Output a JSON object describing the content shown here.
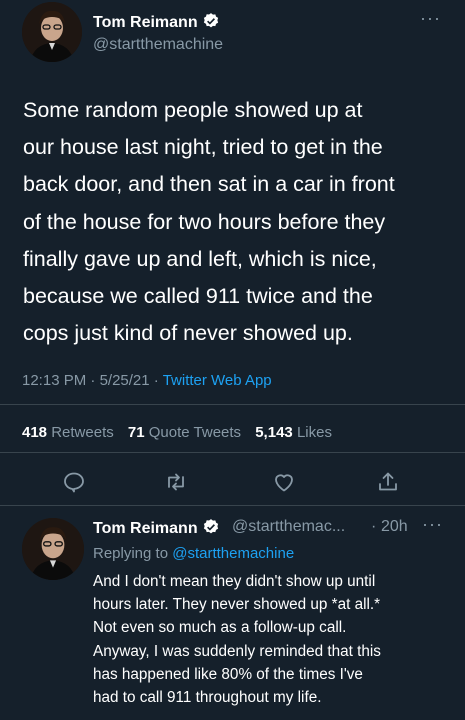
{
  "main_tweet": {
    "author_name": "Tom Reimann",
    "handle": "@startthemachine",
    "more_label": "···",
    "text": "Some random people showed up at\nour house last night, tried to get in the\nback door, and then sat in a car in front\nof the house for two hours before they\nfinally gave up and left, which is nice,\nbecause we called 911 twice and the\ncops just kind of never showed up.",
    "time": "12:13 PM",
    "date": "5/25/21",
    "separator": "·",
    "source": "Twitter Web App",
    "stats": {
      "retweets_count": "418",
      "retweets_label": "Retweets",
      "quotes_count": "71",
      "quotes_label": "Quote Tweets",
      "likes_count": "5,143",
      "likes_label": "Likes"
    },
    "actions": [
      "reply-icon",
      "retweet-icon",
      "like-icon",
      "share-icon"
    ]
  },
  "reply_tweet": {
    "author_name": "Tom Reimann",
    "handle": "@startthemac...",
    "separator": "·",
    "age": "20h",
    "more_label": "···",
    "replying_to_label": "Replying to",
    "replying_to_handle": "@startthemachine",
    "text": "And I don't mean they didn't show up until\nhours later. They never showed up *at all.*\nNot even so much as a follow-up call.\nAnyway, I was suddenly reminded that this\nhas happened like 80% of the times I've\nhad to call 911 throughout my life."
  },
  "colors": {
    "background": "#15202b",
    "text": "#ffffff",
    "secondary": "#8899a6",
    "accent": "#1da1f2",
    "divider": "#38444d"
  }
}
